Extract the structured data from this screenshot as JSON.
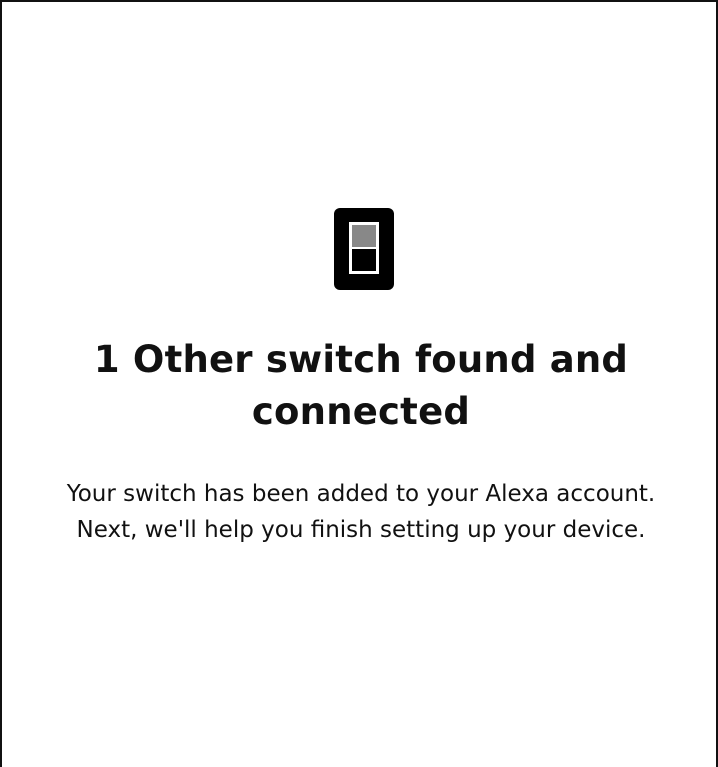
{
  "screen": {
    "icon": "switch-icon",
    "title": "1 Other switch found and connected",
    "message": "Your switch has been added to your Alexa account. Next, we'll help you finish setting up your device."
  },
  "colors": {
    "text": "#111111",
    "icon_body": "#000000",
    "icon_toggle_on": "#888888",
    "icon_toggle_off": "#000000",
    "background": "#ffffff"
  }
}
